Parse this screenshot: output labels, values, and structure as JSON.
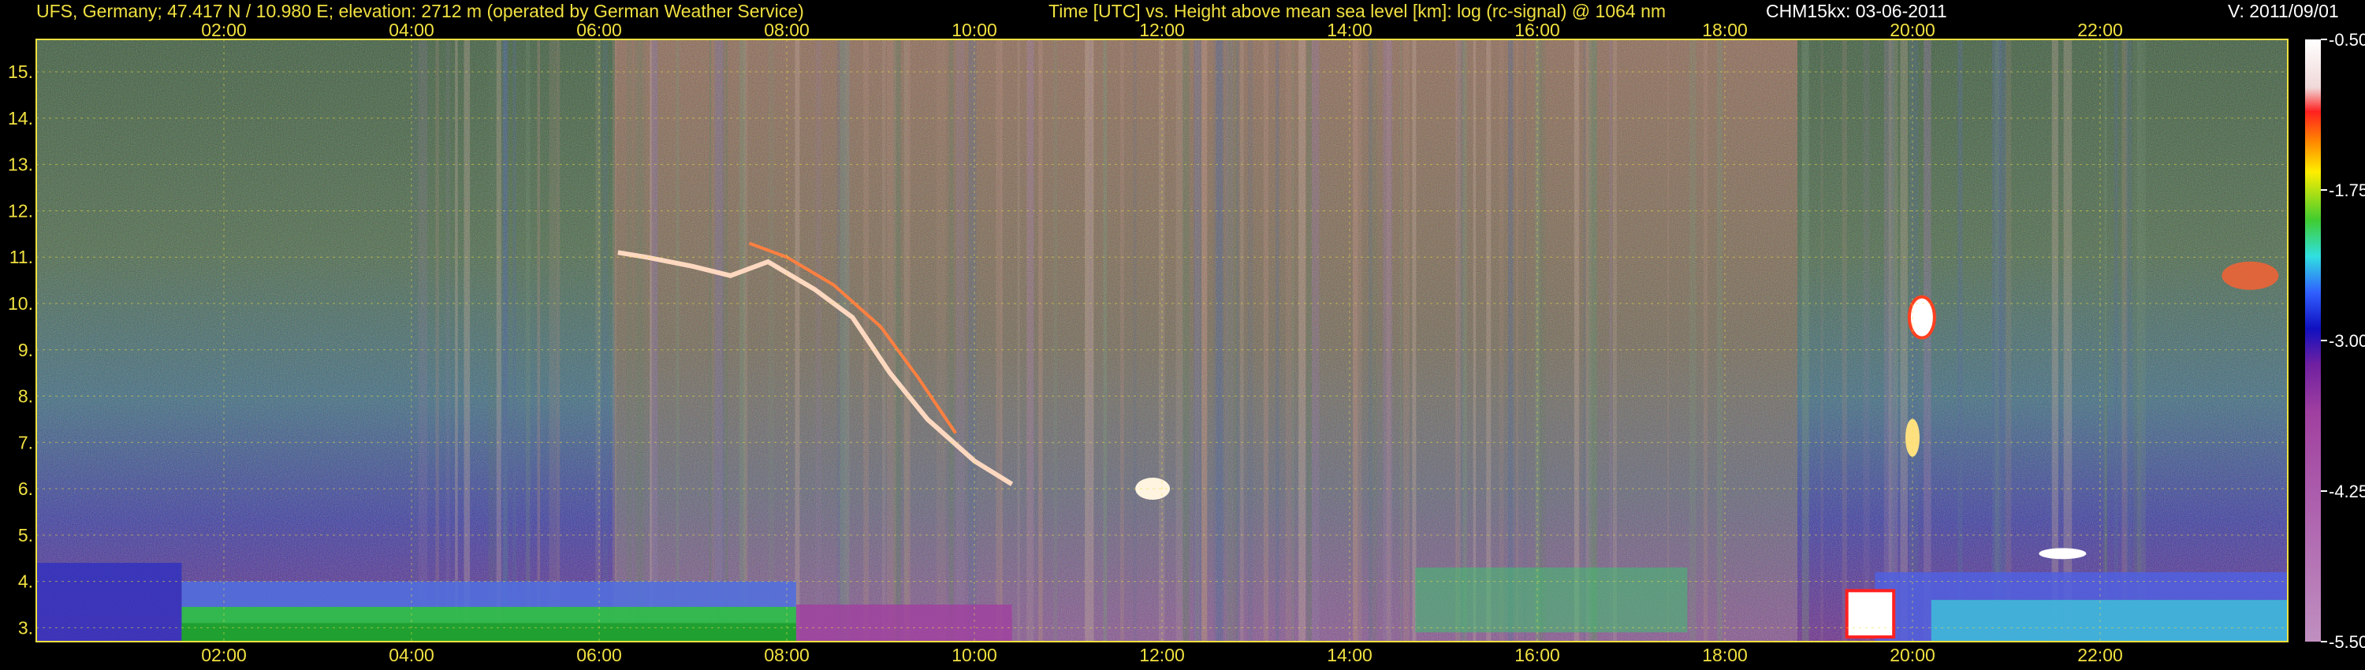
{
  "header": {
    "station": "UFS, Germany; 47.417 N / 10.980 E; elevation: 2712 m  (operated by German Weather Service)",
    "axes_desc": "Time [UTC] vs. Height above mean sea level [km]: log (rc-signal) @ 1064 nm",
    "instrument_date": "CHM15kx: 03-06-2011",
    "version": "V: 2011/09/01"
  },
  "chart_data": {
    "type": "heatmap",
    "title": "Time [UTC] vs. Height above mean sea level [km]: log (rc-signal) @ 1064 nm",
    "xlabel": "Time [UTC]",
    "ylabel": "Height above mean sea level [km]",
    "x_range_hours": [
      0,
      24
    ],
    "y_range_km": [
      2.7,
      15.7
    ],
    "x_ticks": [
      "02:00",
      "04:00",
      "06:00",
      "08:00",
      "10:00",
      "12:00",
      "14:00",
      "16:00",
      "18:00",
      "20:00",
      "22:00"
    ],
    "y_ticks": [
      "3.",
      "4.",
      "5.",
      "6.",
      "7.",
      "8.",
      "9.",
      "10.",
      "11.",
      "12.",
      "13.",
      "14.",
      "15."
    ],
    "grid": true,
    "colorbar": {
      "ticks": [
        "-0.50",
        "-1.75",
        "-3.00",
        "-4.25",
        "-5.50"
      ],
      "range": [
        -5.5,
        -0.5
      ],
      "colors": [
        "#ffffff",
        "#f0d8d8",
        "#ff2020",
        "#ff8800",
        "#ffee00",
        "#40cc30",
        "#30e0e0",
        "#3060ff",
        "#1010c0",
        "#7020a0",
        "#a040a0",
        "#c090c0"
      ]
    },
    "colors": {
      "axis_text": "#f0e040",
      "grid": "#f0e040",
      "background": "#000000"
    }
  }
}
